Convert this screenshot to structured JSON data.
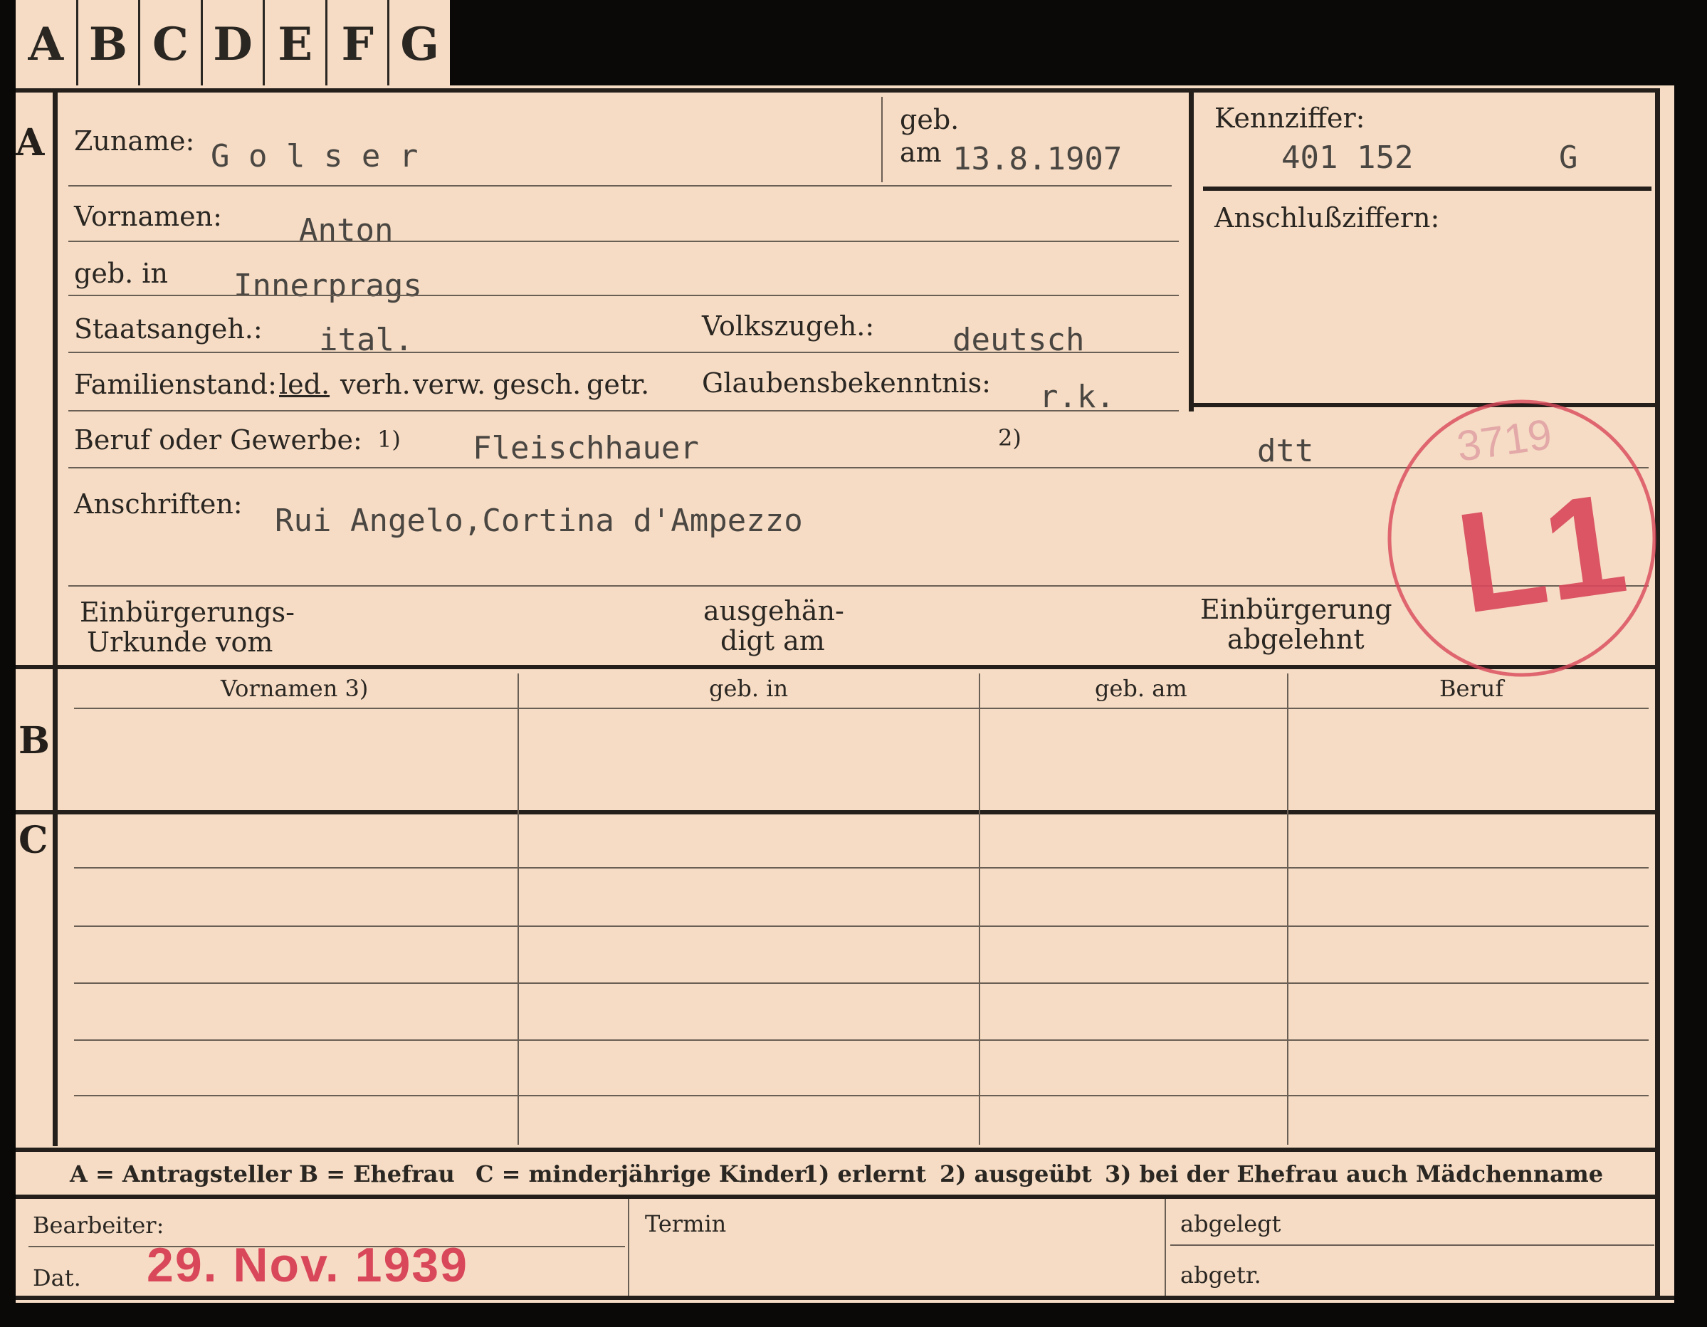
{
  "tabs": [
    "A",
    "B",
    "C",
    "D",
    "E",
    "F",
    "G"
  ],
  "sections": {
    "a": "A",
    "b": "B",
    "c": "C"
  },
  "labels": {
    "zuname": "Zuname:",
    "geb": "geb.",
    "am": "am",
    "kennziffer": "Kennziffer:",
    "anschluss": "Anschlußziffern:",
    "vornamen": "Vornamen:",
    "gebin": "geb. in",
    "staats": "Staatsangeh.:",
    "volks": "Volkszugeh.:",
    "familienstand": "Familienstand:",
    "fam_options": [
      "led.",
      "verh.",
      "verw.",
      "gesch.",
      "getr."
    ],
    "glauben": "Glaubensbekenntnis:",
    "beruf": "Beruf oder Gewerbe:",
    "fn1": "1)",
    "fn2": "2)",
    "anschriften": "Anschriften:",
    "einb1": "Einbürgerungs-",
    "einb2": "Urkunde vom",
    "ausg1": "ausgehän-",
    "ausg2": "digt am",
    "abg1": "Einbürgerung",
    "abg2": "abgelehnt"
  },
  "values": {
    "zuname": "G o l s e r",
    "geb_am": "13.8.1907",
    "kennziffer": "401 152",
    "kennziffer_suffix": "G",
    "vornamen": "Anton",
    "geb_in": "Innerprags",
    "staatsangeh": "ital.",
    "volkszugeh": "deutsch",
    "glauben": "r.k.",
    "beruf": "Fleischhauer",
    "beruf2": "dtt",
    "anschrift": "Rui Angelo,Cortina d'Ampezzo"
  },
  "stamp": {
    "number": "3719",
    "code": "L1",
    "color": "#d9475a"
  },
  "table": {
    "headers": [
      "Vornamen 3)",
      "geb. in",
      "geb. am",
      "Beruf"
    ]
  },
  "legend": {
    "a": "A = Antragsteller",
    "b": "B = Ehefrau",
    "c": "C = minderjährige Kinder",
    "f1": "1) erlernt",
    "f2": "2) ausgeübt",
    "f3": "3) bei der Ehefrau auch Mädchenname"
  },
  "footer": {
    "bearbeiter": "Bearbeiter:",
    "dat": "Dat.",
    "date_stamp": "29. Nov. 1939",
    "termin": "Termin",
    "abgelegt": "abgelegt",
    "abgetr": "abgetr."
  }
}
